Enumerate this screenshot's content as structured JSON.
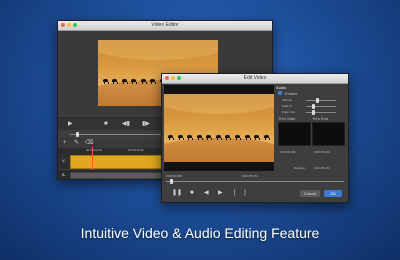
{
  "main_window": {
    "title": "Video Editor",
    "ruler_marks": [
      "00:00:00:00",
      "00:00:15:00",
      "00:00:30:00"
    ],
    "track_labels": [
      "V",
      "A"
    ]
  },
  "edit_window": {
    "title": "Edit Video",
    "audio_section": "Audio",
    "enable_label": "Enable",
    "volume_label": "Volume",
    "fade_in_label": "Fade In",
    "fade_out_label": "Fade Out",
    "trim_start_label": "Trim Start",
    "trim_end_label": "Trim End",
    "start_time": "0:00:00.000",
    "end_time": "0:00:05.000",
    "current_time": "0:00:00.000",
    "total_time": "0:00:05.471",
    "duration_label": "Duration",
    "duration_value": "0:00:05.471",
    "cancel_label": "Cancel",
    "ok_label": "OK"
  },
  "caption": "Intuitive Video & Audio Editing Feature",
  "colors": {
    "accent": "#3a7bd5",
    "clip": "#e0a81e",
    "background": "#1d4f9a"
  }
}
